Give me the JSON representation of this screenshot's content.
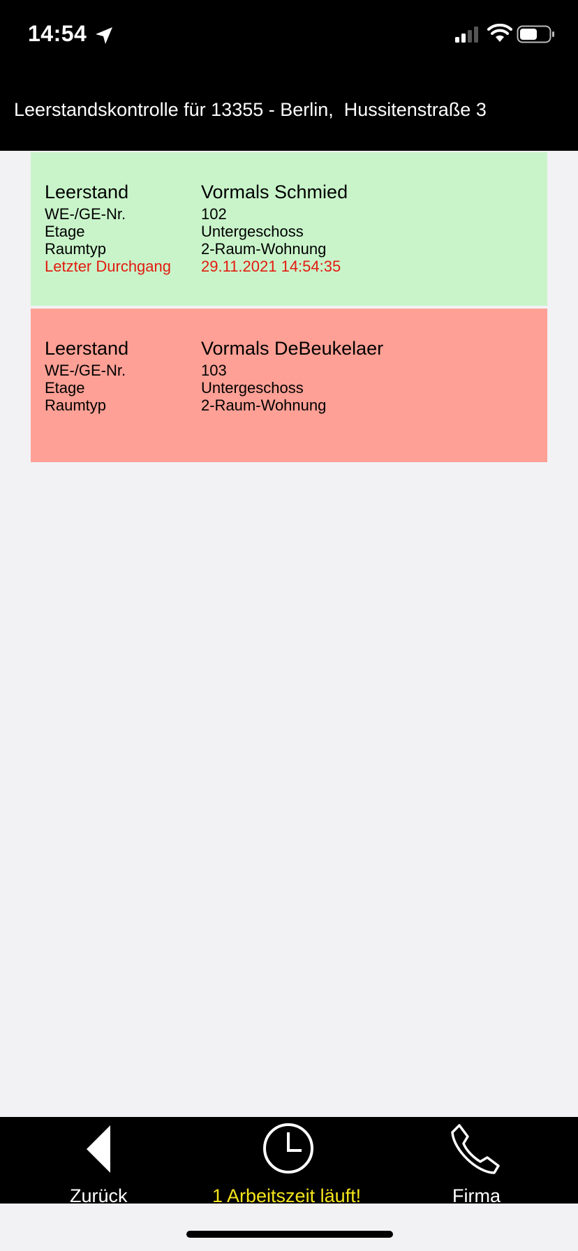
{
  "status_bar": {
    "time": "14:54"
  },
  "header": {
    "title": "Leerstandskontrolle für 13355 - Berlin,  Hussitenstraße 3"
  },
  "units": [
    {
      "status": "green",
      "rows": [
        {
          "label": "Leerstand",
          "value": "Vormals Schmied"
        },
        {
          "label": "WE-/GE-Nr.",
          "value": "102"
        },
        {
          "label": "Etage",
          "value": "Untergeschoss"
        },
        {
          "label": "Raumtyp",
          "value": "2-Raum-Wohnung"
        },
        {
          "label": "Letzter Durchgang",
          "value": "29.11.2021 14:54:35"
        }
      ]
    },
    {
      "status": "red",
      "rows": [
        {
          "label": "Leerstand",
          "value": "Vormals DeBeukelaer"
        },
        {
          "label": "WE-/GE-Nr.",
          "value": "103"
        },
        {
          "label": "Etage",
          "value": "Untergeschoss"
        },
        {
          "label": "Raumtyp",
          "value": "2-Raum-Wohnung"
        }
      ]
    }
  ],
  "tab_bar": {
    "back_label": "Zurück",
    "worktime_label": "1 Arbeitszeit läuft!",
    "company_label": "Firma"
  },
  "colors": {
    "card_done": "#c9f4ca",
    "card_pending": "#fea095",
    "highlight_text": "#e21b0f",
    "worktime_text": "#f5e51b"
  }
}
